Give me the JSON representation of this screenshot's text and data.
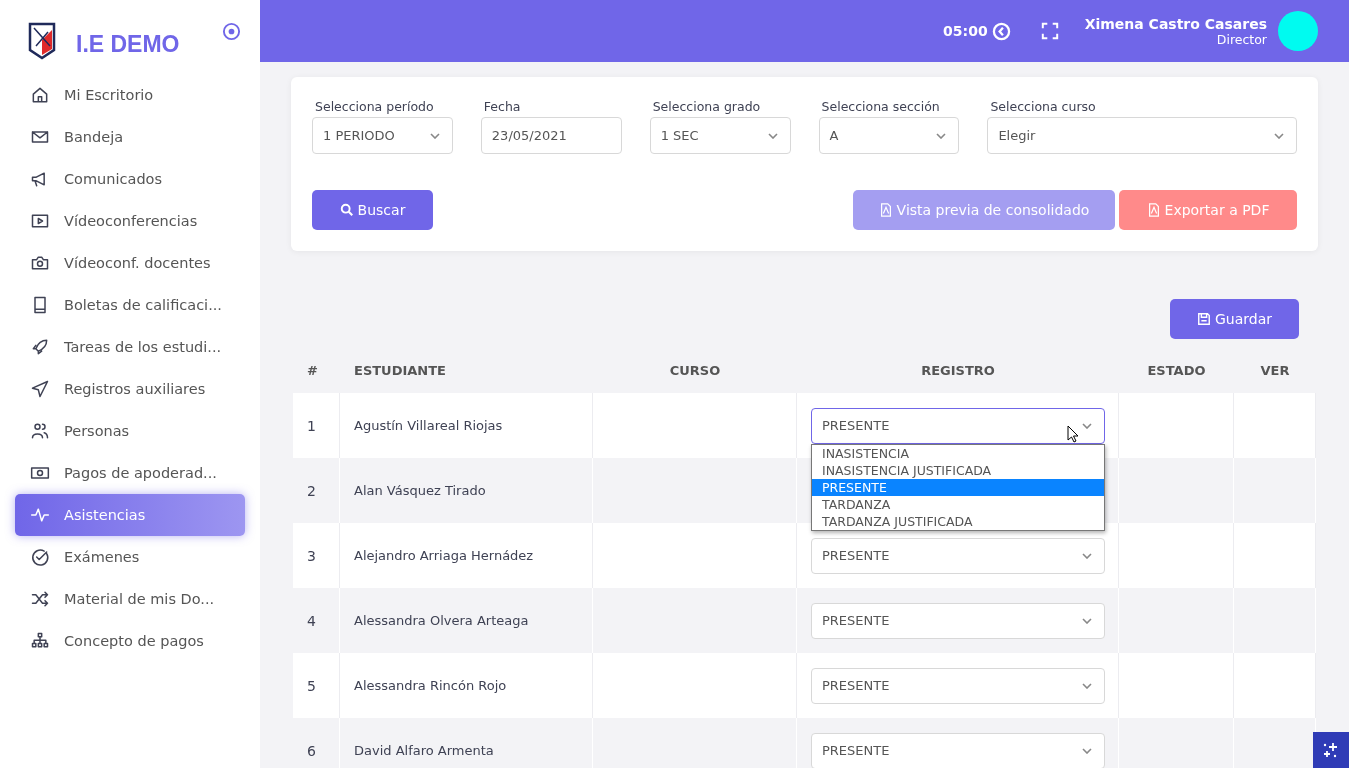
{
  "sidebar": {
    "brand": "I.E DEMO",
    "items": [
      {
        "label": "Mi Escritorio",
        "selected": false
      },
      {
        "label": "Bandeja",
        "selected": false
      },
      {
        "label": "Comunicados",
        "selected": false
      },
      {
        "label": "Vídeoconferencias",
        "selected": false
      },
      {
        "label": "Vídeoconf. docentes",
        "selected": false
      },
      {
        "label": "Boletas de calificaci...",
        "selected": false
      },
      {
        "label": "Tareas de los estudi...",
        "selected": false
      },
      {
        "label": "Registros auxiliares",
        "selected": false
      },
      {
        "label": "Personas",
        "selected": false
      },
      {
        "label": "Pagos de apoderad...",
        "selected": false
      },
      {
        "label": "Asistencias",
        "selected": true
      },
      {
        "label": "Exámenes",
        "selected": false
      },
      {
        "label": "Material de mis Do...",
        "selected": false
      },
      {
        "label": "Concepto de pagos",
        "selected": false
      }
    ]
  },
  "header": {
    "timer": "05:00",
    "user_name": "Ximena Castro Casares",
    "user_role": "Director"
  },
  "filters": [
    {
      "label": "Selecciona período",
      "value": "1 PERIODO",
      "kind": "select"
    },
    {
      "label": "Fecha",
      "value": "23/05/2021",
      "kind": "date"
    },
    {
      "label": "Selecciona grado",
      "value": "1 SEC",
      "kind": "select"
    },
    {
      "label": "Selecciona sección",
      "value": "A",
      "kind": "select"
    },
    {
      "label": "Selecciona curso",
      "value": "Elegir",
      "kind": "select"
    }
  ],
  "buttons": {
    "search": "Buscar",
    "preview": "Vista previa de consolidado",
    "export": "Exportar a PDF",
    "save": "Guardar"
  },
  "table": {
    "columns": [
      "#",
      "ESTUDIANTE",
      "CURSO",
      "REGISTRO",
      "ESTADO",
      "VER"
    ],
    "rows": [
      {
        "number": "1",
        "student": "Agustín Villareal Riojas",
        "registro": "PRESENTE",
        "open": true
      },
      {
        "number": "2",
        "student": "Alan Vásquez Tirado",
        "open": false
      },
      {
        "number": "3",
        "student": "Alejandro Arriaga Hernádez",
        "registro": "PRESENTE",
        "open": false
      },
      {
        "number": "4",
        "student": "Alessandra Olvera Arteaga",
        "registro": "PRESENTE",
        "open": false
      },
      {
        "number": "5",
        "student": "Alessandra Rincón Rojo",
        "registro": "PRESENTE",
        "open": false
      },
      {
        "number": "6",
        "student": "David Alfaro Armenta",
        "registro": "PRESENTE",
        "open": false
      }
    ]
  },
  "dropdown_options": [
    {
      "label": "INASISTENCIA",
      "selected": false
    },
    {
      "label": "INASISTENCIA JUSTIFICADA",
      "selected": false
    },
    {
      "label": "PRESENTE",
      "selected": true
    },
    {
      "label": "TARDANZA",
      "selected": false
    },
    {
      "label": "TARDANZA JUSTIFICADA",
      "selected": false
    }
  ]
}
